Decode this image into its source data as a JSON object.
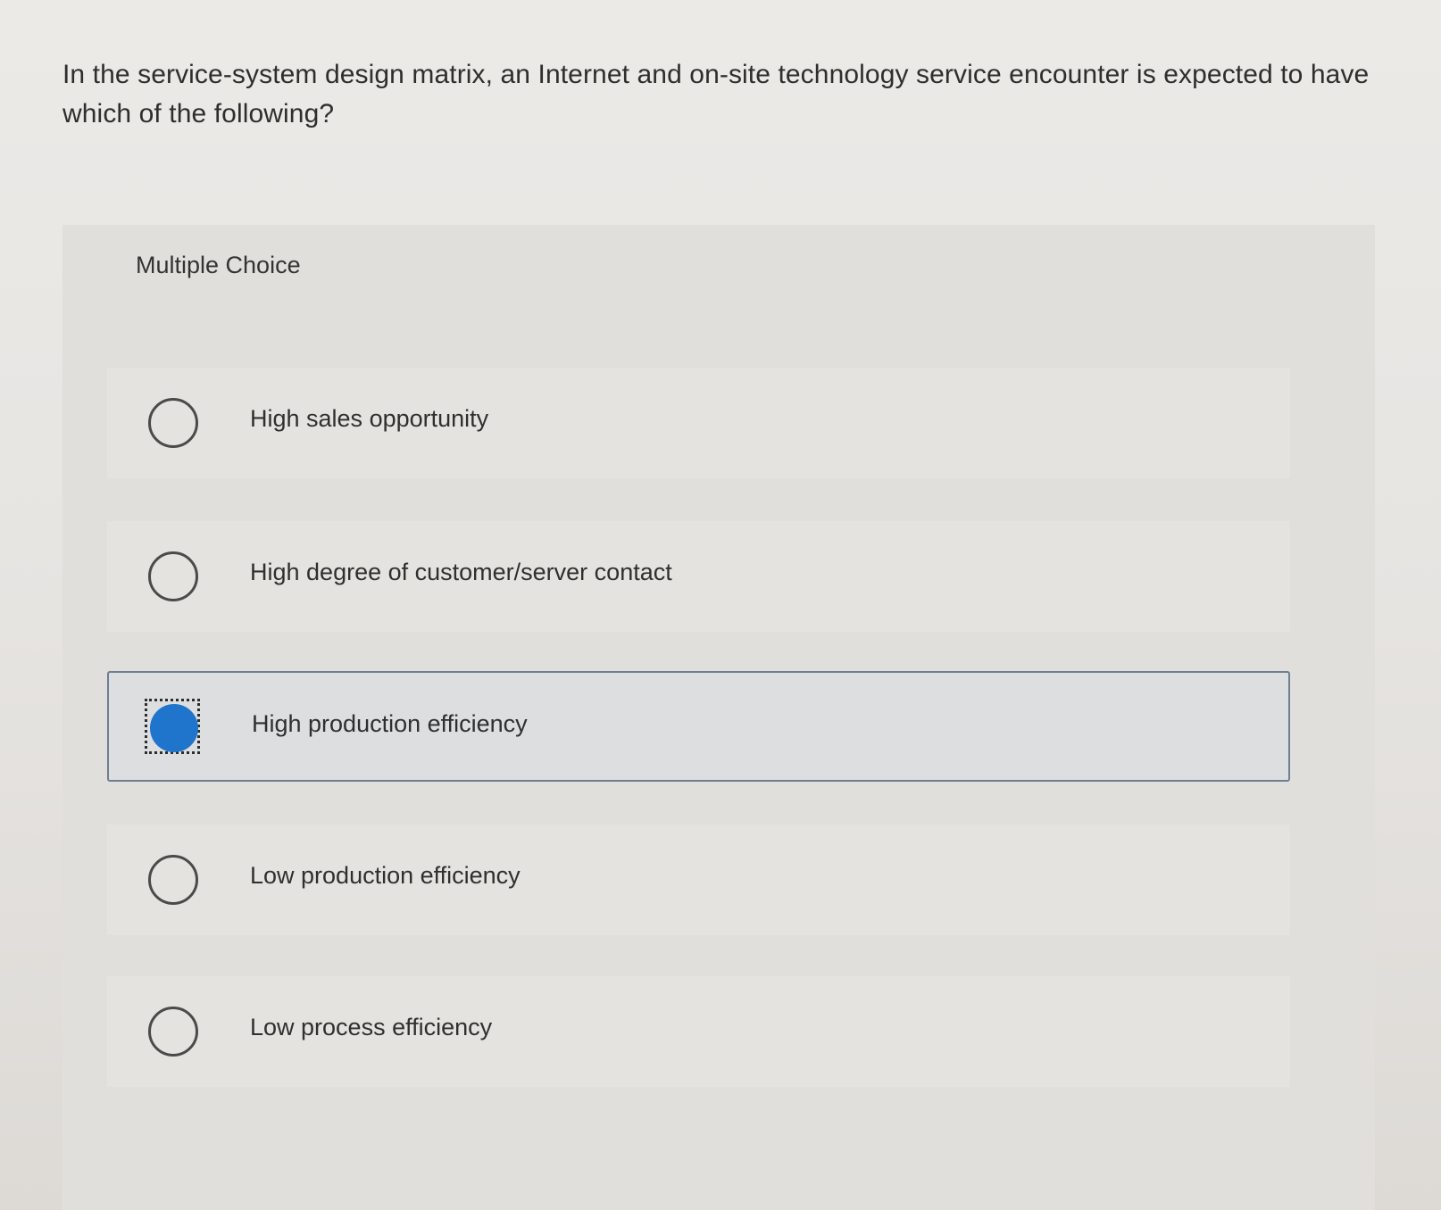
{
  "question": {
    "text": "In the service-system design matrix, an Internet and on-site technology service encounter is expected to have which of the following?"
  },
  "panel": {
    "title": "Multiple Choice"
  },
  "options": [
    {
      "label": "High sales opportunity",
      "selected": false
    },
    {
      "label": "High degree of customer/server contact",
      "selected": false
    },
    {
      "label": "High production efficiency",
      "selected": true
    },
    {
      "label": "Low production efficiency",
      "selected": false
    },
    {
      "label": "Low process efficiency",
      "selected": false
    }
  ],
  "colors": {
    "selected_radio": "#1f74cc",
    "selected_border": "#6c7f93"
  }
}
